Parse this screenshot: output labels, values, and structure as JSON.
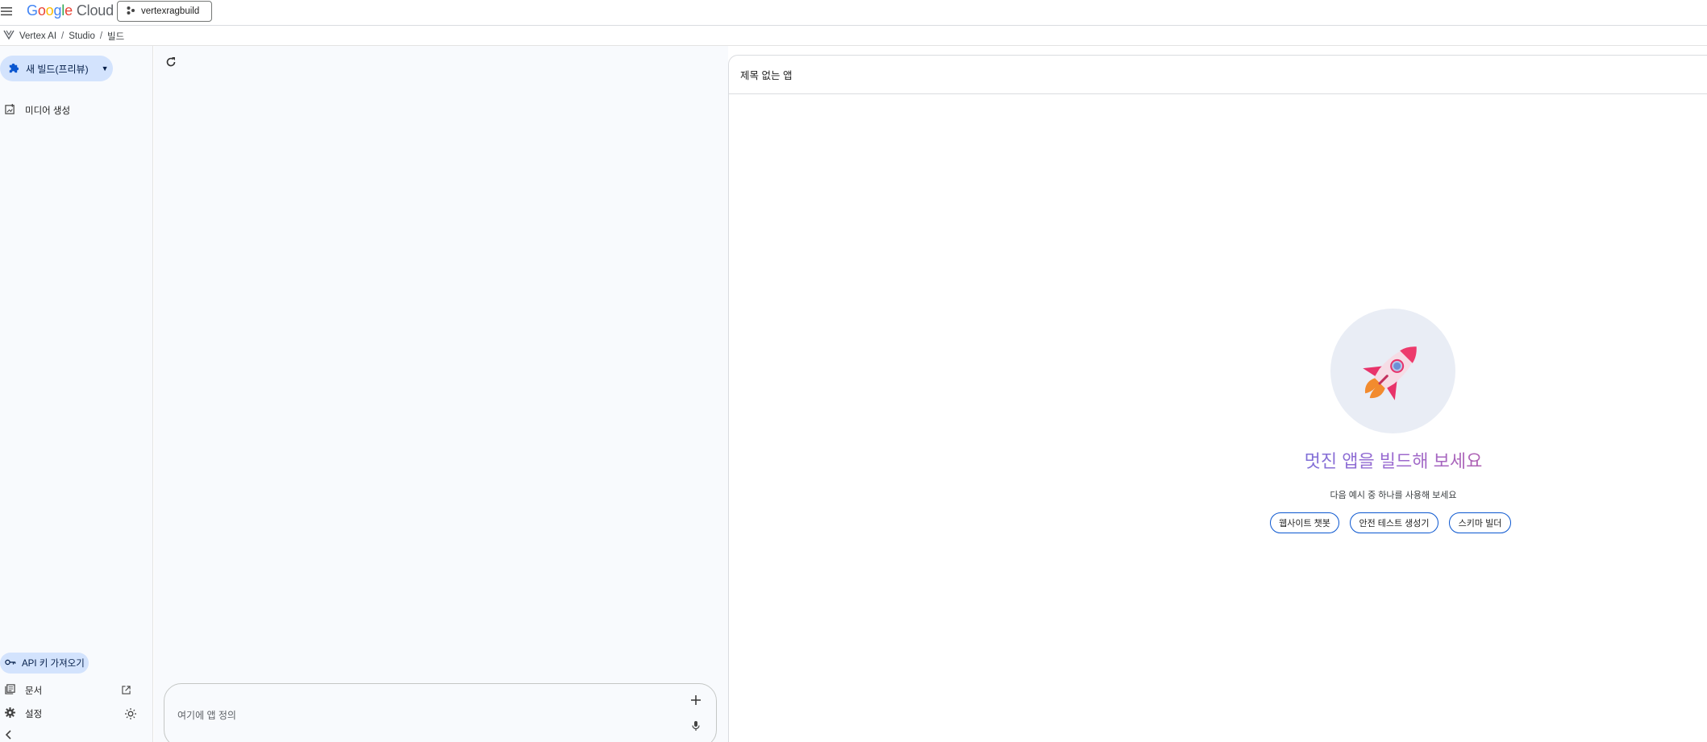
{
  "topbar": {
    "logo_google": [
      "G",
      "o",
      "o",
      "g",
      "l",
      "e"
    ],
    "logo_cloud": "Cloud",
    "project_label": "vertexragbuild"
  },
  "breadcrumb": {
    "items": [
      "Vertex AI",
      "Studio",
      "빌드"
    ],
    "separator": "/"
  },
  "sidebar": {
    "new_build_label": "새 빌드(프리뷰)",
    "media_label": "미디어 생성",
    "api_key_label": "API 키 가져오기",
    "docs_label": "문서",
    "settings_label": "설정"
  },
  "prompt": {
    "placeholder": "여기에 앱 정의",
    "value": ""
  },
  "preview": {
    "title": "제목 없는 앱",
    "hero_title": "멋진 앱을 빌드해 보세요",
    "hero_subtitle": "다음 예시 중 하나를 사용해 보세요",
    "examples": [
      "웹사이트 챗봇",
      "안전 테스트 생성기",
      "스키마 빌더"
    ]
  },
  "colors": {
    "accent": "#0b57d0",
    "selected_bg": "#d3e3fd",
    "sidebar_bg": "#f8fafd"
  },
  "icons": [
    "menu-icon",
    "project-icon",
    "vertex-icon",
    "puzzle-icon",
    "image-plus-icon",
    "key-icon",
    "docs-icon",
    "open-external-icon",
    "gear-icon",
    "sun-icon",
    "chevron-left-icon",
    "refresh-icon",
    "plus-icon",
    "mic-icon",
    "rocket-icon"
  ]
}
